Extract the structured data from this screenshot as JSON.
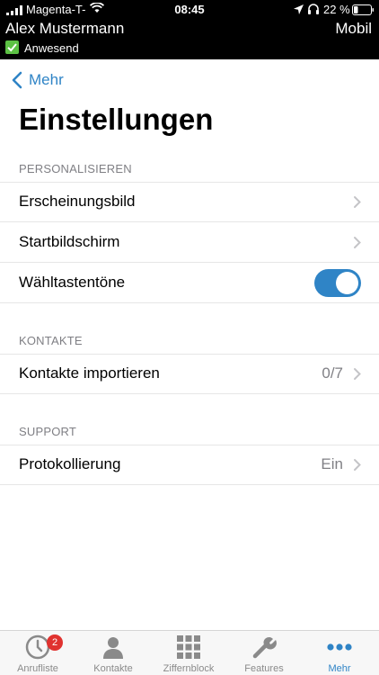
{
  "status_bar": {
    "carrier": "Magenta-T-",
    "time": "08:45",
    "battery": "22 %"
  },
  "header": {
    "user_name": "Alex Mustermann",
    "device": "Mobil",
    "presence": "Anwesend"
  },
  "nav": {
    "back_label": "Mehr",
    "title": "Einstellungen"
  },
  "sections": {
    "personalisieren": {
      "header": "PERSONALISIEREN",
      "items": [
        {
          "label": "Erscheinungsbild"
        },
        {
          "label": "Startbildschirm"
        },
        {
          "label": "Wähltastentöne",
          "toggle_on": true
        }
      ]
    },
    "kontakte": {
      "header": "KONTAKTE",
      "items": [
        {
          "label": "Kontakte importieren",
          "value": "0/7"
        }
      ]
    },
    "support": {
      "header": "SUPPORT",
      "items": [
        {
          "label": "Protokollierung",
          "value": "Ein"
        }
      ]
    }
  },
  "tabbar": {
    "tabs": [
      {
        "label": "Anrufliste",
        "icon": "clock-icon",
        "badge": "2"
      },
      {
        "label": "Kontakte",
        "icon": "person-icon"
      },
      {
        "label": "Ziffernblock",
        "icon": "keypad-icon"
      },
      {
        "label": "Features",
        "icon": "wrench-icon"
      },
      {
        "label": "Mehr",
        "icon": "more-dots-icon",
        "active": true
      }
    ]
  },
  "colors": {
    "accent": "#2f84c6",
    "presence": "#5cc144",
    "badge": "#e0322f"
  }
}
